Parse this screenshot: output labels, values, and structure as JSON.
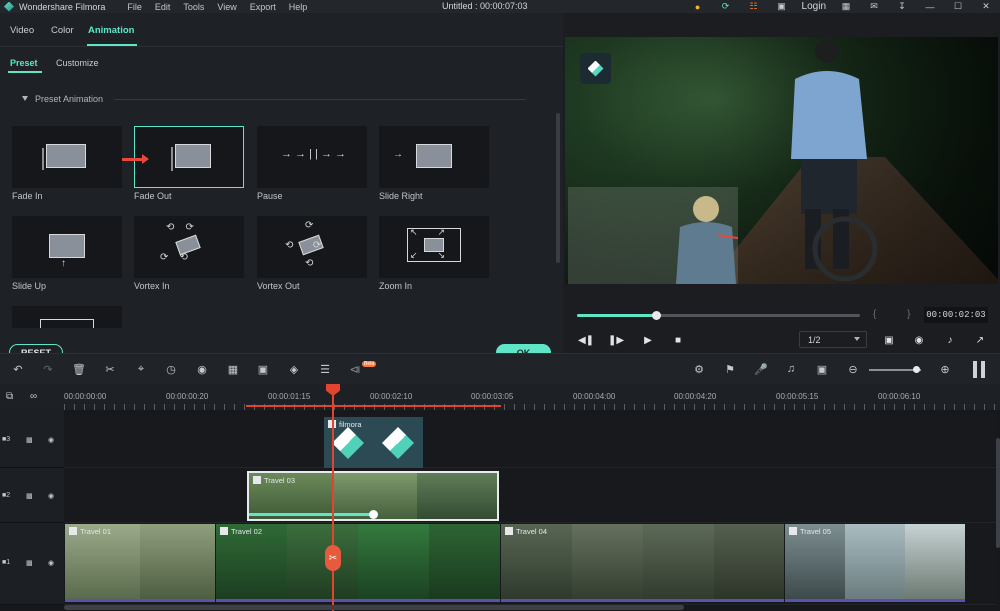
{
  "app": {
    "name": "Wondershare Filmora",
    "doc_title": "Untitled : 00:00:07:03",
    "menu": [
      "File",
      "Edit",
      "Tools",
      "View",
      "Export",
      "Help"
    ],
    "login": "Login"
  },
  "panel": {
    "tabs": [
      "Video",
      "Color",
      "Animation"
    ],
    "subtabs": [
      "Preset",
      "Customize"
    ],
    "preset_header": "Preset Animation",
    "presets": [
      "Fade In",
      "Fade Out",
      "Pause",
      "Slide Right",
      "Slide Up",
      "Vortex In",
      "Vortex Out",
      "Zoom In"
    ],
    "pause_glyph": "→ → | | → →",
    "reset": "RESET",
    "ok": "OK"
  },
  "preview": {
    "timecode": "00:00:02:03",
    "ratio": "1/2",
    "progress": 0.28,
    "brackets": "{ }"
  },
  "toolbar": {
    "beta": "Beta"
  },
  "timeline": {
    "ruler": [
      "00:00:00:00",
      "00:00:00:20",
      "00:00:01:15",
      "00:00:02:10",
      "00:00:03:05",
      "00:00:04:00",
      "00:00:04:20",
      "00:00:05:15",
      "00:00:06:10"
    ],
    "clips": {
      "overlay": "filmora",
      "pip": "Travel 03",
      "main": [
        "Travel 01",
        "Travel 02",
        "Travel 04",
        "Travel 05"
      ]
    }
  },
  "colors": {
    "accent": "#5fe6c8",
    "playhead": "#e2452f"
  }
}
